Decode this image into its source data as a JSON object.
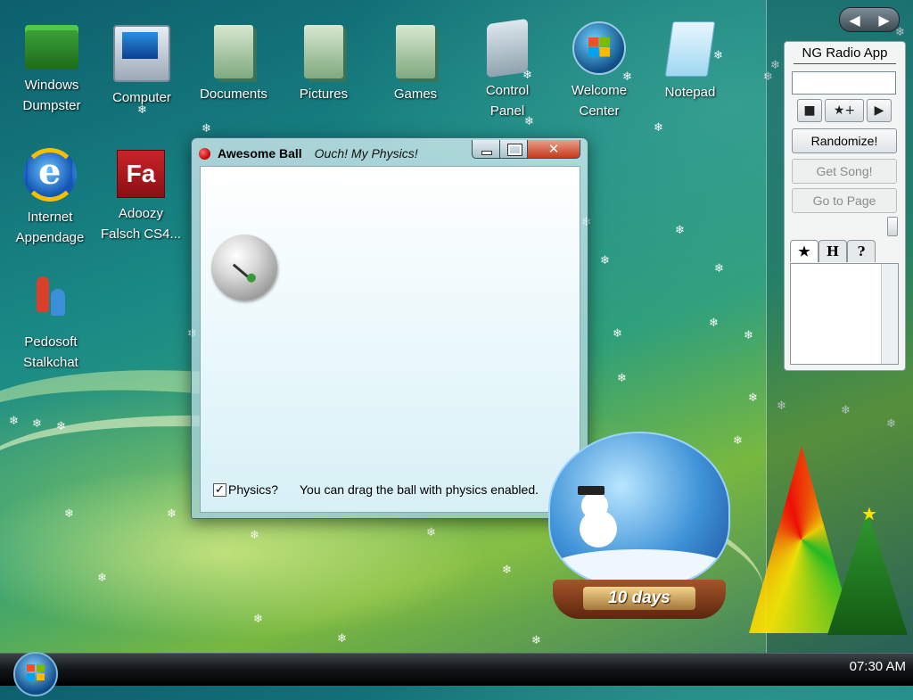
{
  "desktop": {
    "icons": [
      {
        "label": "Windows\nDumpster",
        "icon": "dumpster-icon"
      },
      {
        "label": "Computer",
        "icon": "computer-icon"
      },
      {
        "label": "Documents",
        "icon": "documents-folder-icon"
      },
      {
        "label": "Pictures",
        "icon": "pictures-folder-icon"
      },
      {
        "label": "Games",
        "icon": "games-folder-icon"
      },
      {
        "label": "Control\nPanel",
        "icon": "control-panel-icon"
      },
      {
        "label": "Welcome\nCenter",
        "icon": "welcome-center-icon"
      },
      {
        "label": "Notepad",
        "icon": "notepad-icon"
      },
      {
        "label": "Internet\nAppendage",
        "icon": "internet-explorer-icon"
      },
      {
        "label": "Adoozy\nFalsch CS4...",
        "icon": "flash-icon"
      },
      {
        "label": "Pedosoft\nStalkchat",
        "icon": "chat-people-icon"
      }
    ],
    "fa_glyph": "Fa"
  },
  "window": {
    "title": "Awesome Ball",
    "subtitle": "Ouch!  My Physics!",
    "close_glyph": "✕",
    "physics_label": "Physics?",
    "physics_checked": true,
    "check_glyph": "✓",
    "hint": "You can drag the ball with physics enabled."
  },
  "radio": {
    "title": "NG Radio App",
    "search_value": "",
    "stop_glyph": "■",
    "favorite_glyph": "★+",
    "play_glyph": "▶",
    "randomize": "Randomize!",
    "get_song": "Get Song!",
    "go_to_page": "Go to Page",
    "tabs": [
      "★",
      "H",
      "?"
    ]
  },
  "sidebar": {
    "prev_glyph": "◀",
    "next_glyph": "▶"
  },
  "gadget": {
    "countdown": "10 days"
  },
  "taskbar": {
    "clock": "07:30 AM"
  },
  "colors": {
    "accent": "#1a8a86",
    "close_button": "#c63a1d",
    "taskbar": "#121518"
  }
}
